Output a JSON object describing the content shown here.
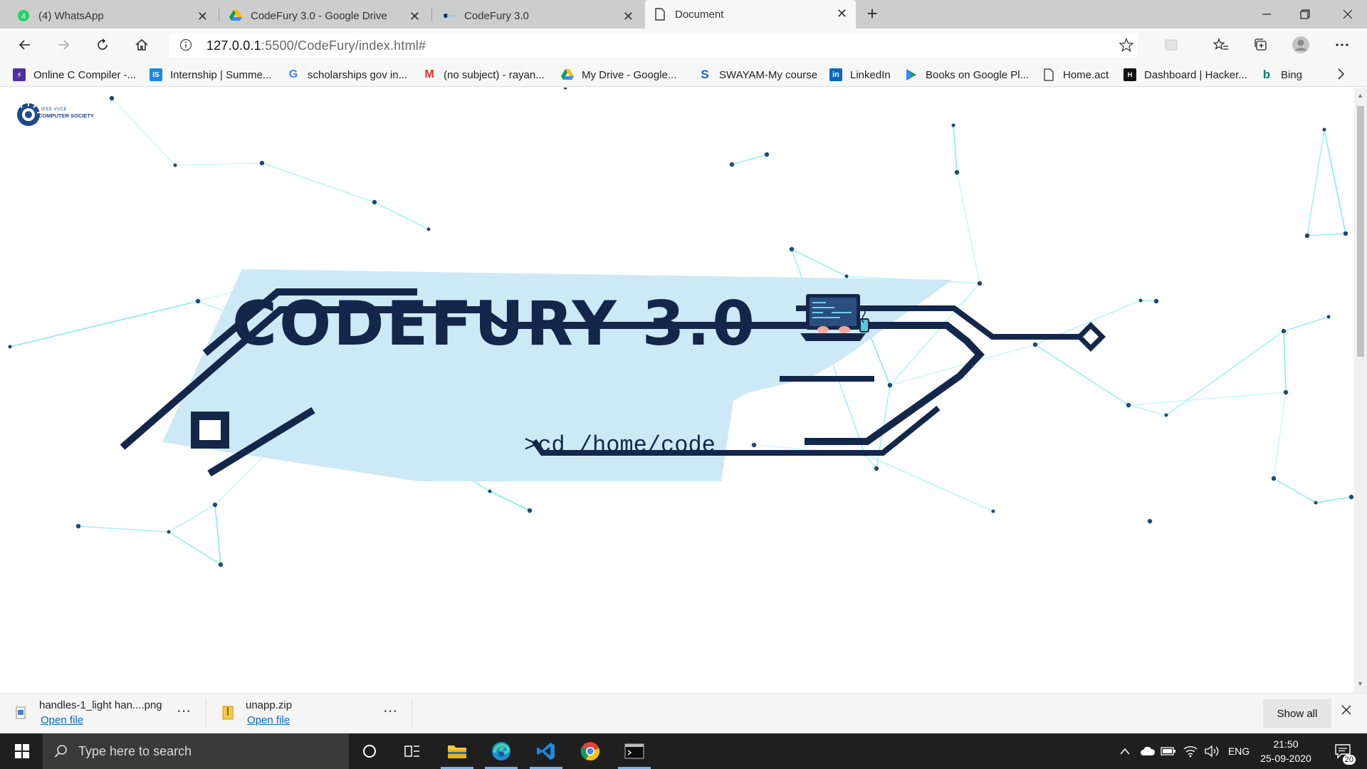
{
  "browser": {
    "tabs": [
      {
        "title": "(4) WhatsApp",
        "icon": "whatsapp-icon",
        "active": false
      },
      {
        "title": "CodeFury 3.0 - Google Drive",
        "icon": "google-drive-icon",
        "active": false
      },
      {
        "title": "CodeFury 3.0",
        "icon": "site-icon",
        "active": false
      },
      {
        "title": "Document",
        "icon": "document-icon",
        "active": true
      }
    ],
    "url_host": "127.0.0.1",
    "url_path": ":5500/CodeFury/index.html#",
    "bookmarks": [
      {
        "label": "Online C Compiler -...",
        "icon": "bolt-icon",
        "color": "#4b2fa3"
      },
      {
        "label": "Internship | Summe...",
        "icon": "IS",
        "color": "#1e88e5"
      },
      {
        "label": "scholarships gov in...",
        "icon": "google-icon",
        "color": "#4285f4"
      },
      {
        "label": "(no subject) - rayan...",
        "icon": "gmail-icon",
        "color": "#d93025"
      },
      {
        "label": "My Drive - Google...",
        "icon": "google-drive-icon",
        "color": "#0f9d58"
      },
      {
        "label": "SWAYAM-My course",
        "icon": "S",
        "color": "#1565c0"
      },
      {
        "label": "LinkedIn",
        "icon": "in",
        "color": "#0a66c2"
      },
      {
        "label": "Books on Google Pl...",
        "icon": "play-icon",
        "color": "#00a173"
      },
      {
        "label": "Home.act",
        "icon": "document-icon",
        "color": "#666666"
      },
      {
        "label": "Dashboard | Hacker...",
        "icon": "H",
        "color": "#111111"
      },
      {
        "label": "Bing",
        "icon": "b",
        "color": "#008373"
      }
    ]
  },
  "page": {
    "logo_line1": "IEEE VVCE",
    "logo_line2": "COMPUTER SOCIETY",
    "hero_title": "CODEFURY 3.0",
    "hero_subtitle": ">cd /home/code",
    "colors": {
      "navy": "#14274a",
      "light_blue": "#cde9f6",
      "network": "#5ce8ec"
    }
  },
  "downloads": {
    "items": [
      {
        "name": "handles-1_light han....png",
        "action": "Open file"
      },
      {
        "name": "unapp.zip",
        "action": "Open file"
      }
    ],
    "show_all": "Show all"
  },
  "taskbar": {
    "search_placeholder": "Type here to search",
    "language": "ENG",
    "time": "21:50",
    "date": "25-09-2020",
    "notifications": "20"
  }
}
